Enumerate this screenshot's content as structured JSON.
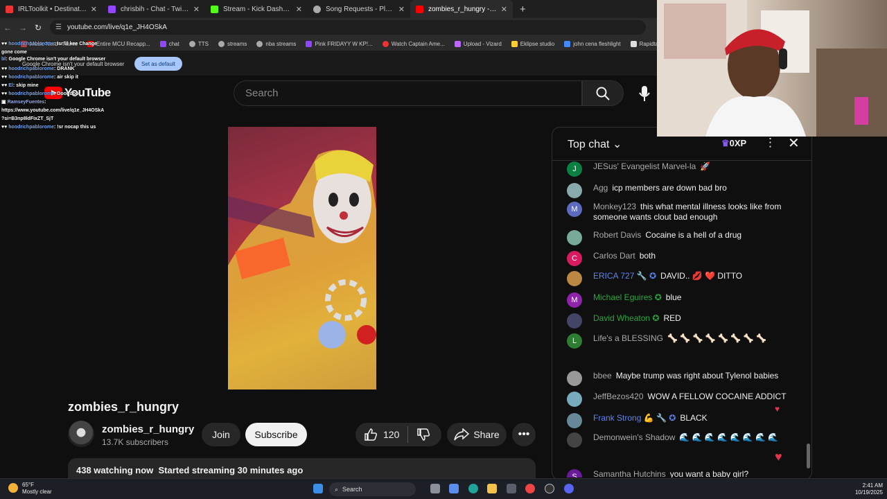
{
  "browser": {
    "tabs": [
      {
        "label": "IRLToolkit • Destinations",
        "color": "#e33"
      },
      {
        "label": "chrisbih - Chat - Twitch",
        "color": "#9146ff"
      },
      {
        "label": "Stream - Kick Dashboard",
        "color": "#53fc18"
      },
      {
        "label": "Song Requests - Playing 24",
        "color": "#aaa"
      },
      {
        "label": "zombies_r_hungry - YouTube",
        "color": "#ff0000"
      }
    ],
    "url": "youtube.com/live/q1e_JH4OSkA",
    "bookmarks": [
      {
        "label": "Music Nerd - Name",
        "color": "#b44"
      },
      {
        "label": "Entire MCU Recapp...",
        "color": "#f00"
      },
      {
        "label": "chat",
        "color": "#9146ff"
      },
      {
        "label": "TTS",
        "color": "#aaa"
      },
      {
        "label": "streams",
        "color": "#aaa"
      },
      {
        "label": "nba streams",
        "color": "#aaa"
      },
      {
        "label": "Pink FRIDAYY W KP!...",
        "color": "#9146ff"
      },
      {
        "label": "Watch Captain Ame...",
        "color": "#e33"
      },
      {
        "label": "Upload - Vizard",
        "color": "#b6f"
      },
      {
        "label": "Eklipse studio",
        "color": "#fc3"
      },
      {
        "label": "john cena fleshlight",
        "color": "#48f"
      },
      {
        "label": "Rapidtags | YouTub...",
        "color": "#ddd"
      }
    ],
    "default_message": "Google Chrome isn't your default browser",
    "set_default_label": "Set as default"
  },
  "overlay_chat": [
    {
      "user": "hoodrichpablorome",
      "text": "Isr lil kee Change"
    },
    {
      "user": "",
      "text": "gone come"
    },
    {
      "user": "bl",
      "text": "Google Chrome isn't your default browser"
    },
    {
      "user": "hoodrichpablorome",
      "text": "DRANK"
    },
    {
      "user": "hoodrichpablorome",
      "text": "air skip it"
    },
    {
      "user": "El",
      "text": "skip mine"
    },
    {
      "user": "hoodrichpablorome",
      "text": "Door door"
    },
    {
      "user": "RamseyFuentes",
      "text": ""
    },
    {
      "user": "",
      "text": "https://www.youtube.com/live/q1e_JH4OSkA"
    },
    {
      "user": "",
      "text": "?si=B3np8ldFixZT_SjT"
    },
    {
      "user": "hoodrichpablorome",
      "text": "!sr nocap this us"
    }
  ],
  "youtube": {
    "logo": "YouTube",
    "search_placeholder": "Search",
    "video_title": "zombies_r_hungry",
    "channel_name": "zombies_r_hungry",
    "subscribers": "13.7K subscribers",
    "join_label": "Join",
    "subscribe_label": "Subscribe",
    "likes": "120",
    "share_label": "Share",
    "watching": "438 watching now",
    "started": "Started streaming 30 minutes ago"
  },
  "chat": {
    "header": "Top chat",
    "xp": "0XP",
    "messages": [
      {
        "author": "JESus' Evangelist Marvel-la",
        "text": "🚀",
        "avatar": "J",
        "avcolor": "#0b8043",
        "kind": ""
      },
      {
        "author": "Agg",
        "text": "icp members are down bad bro",
        "avatar": "",
        "avcolor": "#8aa",
        "kind": ""
      },
      {
        "author": "Monkey123",
        "text": "this what mental illness looks like from someone wants clout bad enough",
        "avatar": "M",
        "avcolor": "#5c6bc0",
        "kind": ""
      },
      {
        "author": "Robert Davis",
        "text": "Cocaine is a hell of a drug",
        "avatar": "",
        "avcolor": "#7a9",
        "kind": ""
      },
      {
        "author": "Carlos Dart",
        "text": "both",
        "avatar": "C",
        "avcolor": "#d81b60",
        "kind": ""
      },
      {
        "author": "ERICA 727 🔧 ✪",
        "text": "DAVID.. 💋 ❤️ DITTO",
        "avatar": "",
        "avcolor": "#b84",
        "kind": "mod"
      },
      {
        "author": "Michael Eguires ✪",
        "text": "blue",
        "avatar": "M",
        "avcolor": "#8e24aa",
        "kind": "mem"
      },
      {
        "author": "David Wheaton ✪",
        "text": "RED",
        "avatar": "",
        "avcolor": "#446",
        "kind": "mem"
      },
      {
        "author": "Life's a BLESSING",
        "text": "🦴 🦴 🦴 🦴 🦴 🦴 🦴 🦴",
        "avatar": "L",
        "avcolor": "#2e7d32",
        "kind": ""
      },
      {
        "author": "bbee",
        "text": "Maybe trump was right about Tylenol babies",
        "avatar": "",
        "avcolor": "#999",
        "kind": ""
      },
      {
        "author": "JeffBezos420",
        "text": "WOW A FELLOW COCAINE ADDICT",
        "avatar": "",
        "avcolor": "#7ab",
        "kind": ""
      },
      {
        "author": "Frank Strong 💪 🔧 ✪",
        "text": "BLACK",
        "avatar": "",
        "avcolor": "#689",
        "kind": "mod"
      },
      {
        "author": "Demonwein's Shadow",
        "text": "🌊 🌊 🌊 🌊 🌊 🌊 🌊 🌊",
        "avatar": "",
        "avcolor": "#444",
        "kind": ""
      },
      {
        "author": "Samantha Hutchins",
        "text": "you want a baby girl?",
        "avatar": "S",
        "avcolor": "#6a1b9a",
        "kind": ""
      }
    ]
  },
  "taskbar": {
    "temp": "65°F",
    "weather": "Mostly clear",
    "search_label": "Search",
    "time": "2:41 AM",
    "date": "10/19/2025"
  }
}
